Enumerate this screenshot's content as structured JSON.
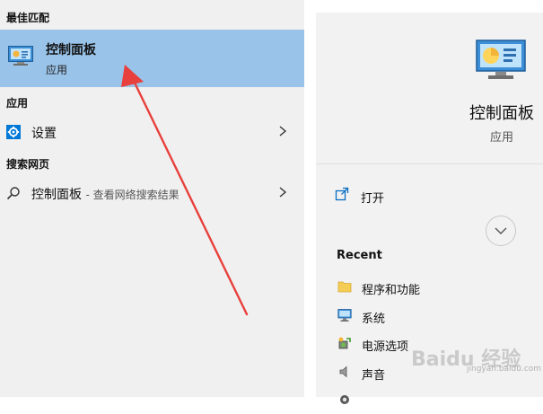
{
  "left": {
    "best_match_header": "最佳匹配",
    "best_match": {
      "title": "控制面板",
      "subtitle": "应用",
      "icon": "control-panel-icon"
    },
    "apps_header": "应用",
    "apps": [
      {
        "label": "设置",
        "icon": "settings-gear-icon"
      }
    ],
    "web_header": "搜索网页",
    "web": [
      {
        "label": "控制面板",
        "hint": "- 查看网络搜索结果",
        "icon": "search-icon"
      }
    ]
  },
  "right": {
    "app_title": "控制面板",
    "app_subtitle": "应用",
    "open_label": "打开",
    "recent_header": "Recent",
    "recent": [
      {
        "label": "程序和功能",
        "icon": "folder-icon"
      },
      {
        "label": "系统",
        "icon": "monitor-icon"
      },
      {
        "label": "电源选项",
        "icon": "power-options-icon"
      },
      {
        "label": "声音",
        "icon": "speaker-icon"
      }
    ]
  },
  "watermark": {
    "brand": "Baidu 经验",
    "sub": "jingyan.baidu.com"
  },
  "colors": {
    "selected_bg": "#99c3e8",
    "left_bg": "#f0f0f0",
    "right_bg": "#f2f2f2",
    "annotation_arrow": "#e8403c",
    "settings_blue": "#0078d7"
  }
}
